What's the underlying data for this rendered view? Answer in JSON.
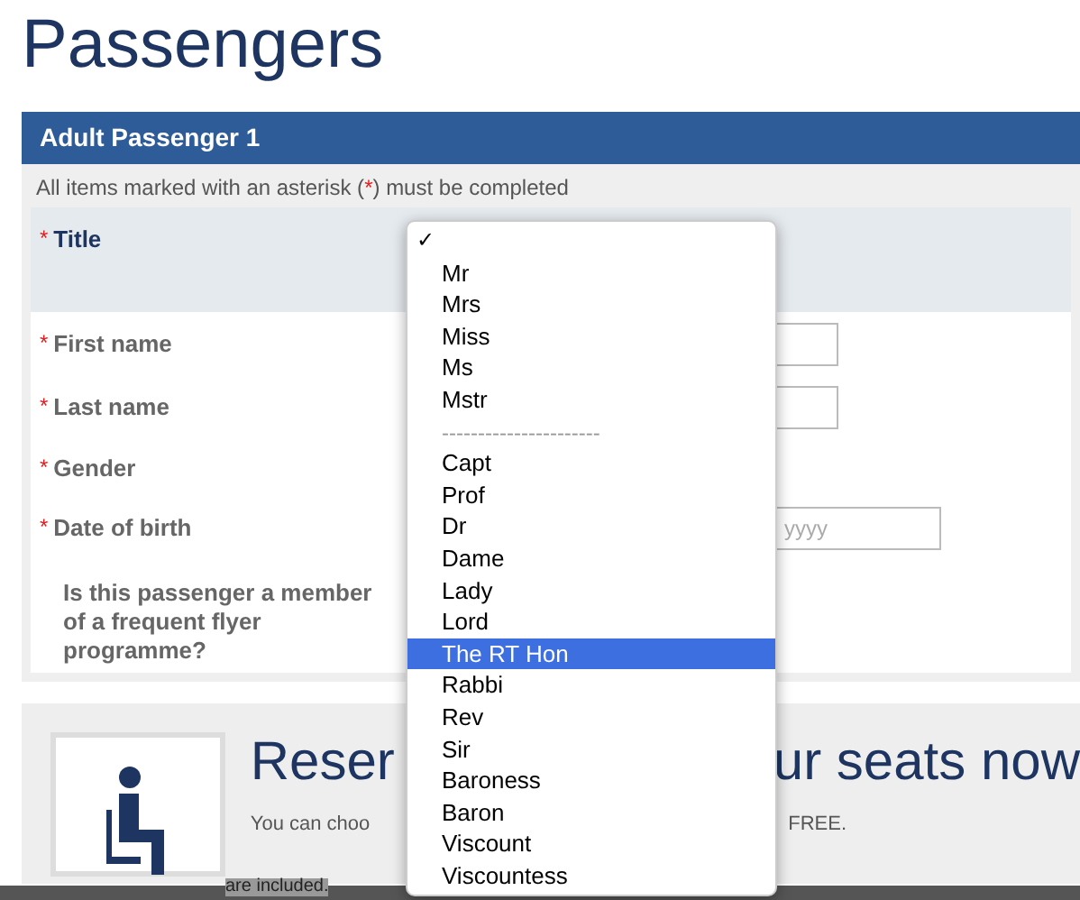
{
  "page_title": "Passengers",
  "passenger_header": "Adult Passenger 1",
  "notice": {
    "before": "All items marked with an asterisk (",
    "mark": "*",
    "after": ") must be completed"
  },
  "required_mark": "*",
  "fields": [
    {
      "label": "Title",
      "required": true,
      "kind": "select"
    },
    {
      "label": "First name",
      "required": true,
      "kind": "text"
    },
    {
      "label": "Last name",
      "required": true,
      "kind": "text"
    },
    {
      "label": "Gender",
      "required": true,
      "kind": "radio"
    },
    {
      "label": "Date of birth",
      "required": true,
      "kind": "date",
      "year_placeholder": "yyyy"
    },
    {
      "label": "Is this passenger a member of a frequent flyer programme?",
      "required": false,
      "kind": "radio"
    }
  ],
  "seats": {
    "heading_start": "Reser",
    "heading_end": "ur seats now",
    "text_start": "You can choo",
    "text_end": "FREE.",
    "text_below": "are included."
  },
  "title_menu": {
    "check_mark": "✓",
    "items": [
      {
        "kind": "option",
        "checked": true,
        "selected": false
      },
      {
        "kind": "option",
        "label": "Mr",
        "checked": false,
        "selected": false
      },
      {
        "kind": "option",
        "label": "Mrs",
        "checked": false,
        "selected": false
      },
      {
        "kind": "option",
        "label": "Miss",
        "checked": false,
        "selected": false
      },
      {
        "kind": "option",
        "label": "Ms",
        "checked": false,
        "selected": false
      },
      {
        "kind": "option",
        "label": "Mstr",
        "checked": false,
        "selected": false
      },
      {
        "kind": "separator",
        "label": "----------------------",
        "checked": false,
        "selected": false
      },
      {
        "kind": "option",
        "label": "Capt",
        "checked": false,
        "selected": false
      },
      {
        "kind": "option",
        "label": "Prof",
        "checked": false,
        "selected": false
      },
      {
        "kind": "option",
        "label": "Dr",
        "checked": false,
        "selected": false
      },
      {
        "kind": "option",
        "label": "Dame",
        "checked": false,
        "selected": false
      },
      {
        "kind": "option",
        "label": "Lady",
        "checked": false,
        "selected": false
      },
      {
        "kind": "option",
        "label": "Lord",
        "checked": false,
        "selected": false
      },
      {
        "kind": "option",
        "label": "The RT Hon",
        "checked": false,
        "selected": true
      },
      {
        "kind": "option",
        "label": "Rabbi",
        "checked": false,
        "selected": false
      },
      {
        "kind": "option",
        "label": "Rev",
        "checked": false,
        "selected": false
      },
      {
        "kind": "option",
        "label": "Sir",
        "checked": false,
        "selected": false
      },
      {
        "kind": "option",
        "label": "Baroness",
        "checked": false,
        "selected": false
      },
      {
        "kind": "option",
        "label": "Baron",
        "checked": false,
        "selected": false
      },
      {
        "kind": "option",
        "label": "Viscount",
        "checked": false,
        "selected": false
      },
      {
        "kind": "option",
        "label": "Viscountess",
        "checked": false,
        "selected": false
      }
    ]
  }
}
